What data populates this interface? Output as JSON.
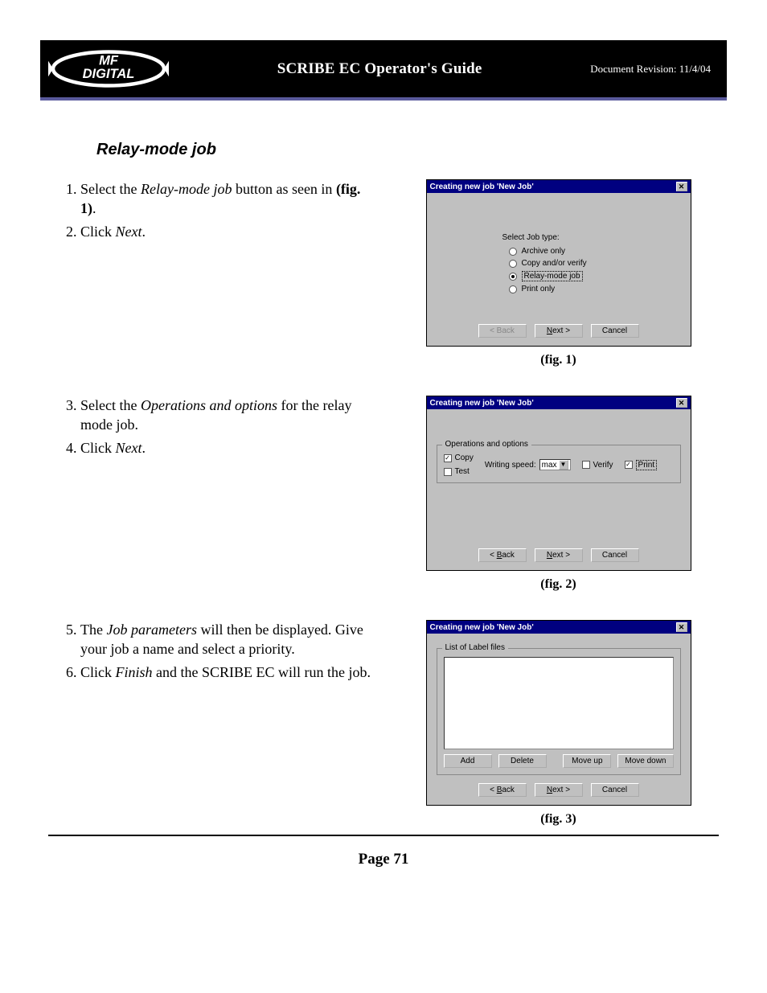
{
  "header": {
    "logo_text": "MF DIGITAL",
    "title": "SCRIBE EC Operator's Guide",
    "revision_label": "Document Revision: ",
    "revision_date": "11/4/04"
  },
  "section_title": "Relay-mode job",
  "steps": {
    "s1_a": "Select the ",
    "s1_em": "Relay-mode job",
    "s1_b": " button as seen in ",
    "s1_fig": "(fig. 1)",
    "s1_c": ".",
    "s2_a": "Click ",
    "s2_em": "Next",
    "s2_b": ".",
    "s3_a": "Select the ",
    "s3_em": "Operations and options",
    "s3_b": " for the relay mode job.",
    "s4_a": "Click ",
    "s4_em": "Next",
    "s4_b": ".",
    "s5_a": "The ",
    "s5_em": "Job parameters",
    "s5_b": " will then be displayed. Give your job a name and select a priority.",
    "s6_a": "Click ",
    "s6_em": "Finish",
    "s6_b": " and the SCRIBE EC will run the job."
  },
  "dialogs": {
    "title": "Creating new job 'New Job'",
    "close_glyph": "✕",
    "back": "< Back",
    "next": "Next >",
    "cancel": "Cancel",
    "fig1": {
      "select_label": "Select Job type:",
      "opt_archive": "Archive only",
      "opt_copy": "Copy and/or verify",
      "opt_relay": "Relay-mode job",
      "opt_print": "Print only"
    },
    "fig2": {
      "group": "Operations and options",
      "copy": "Copy",
      "test": "Test",
      "speed_label": "Writing speed:",
      "speed_value": "max",
      "verify": "Verify",
      "print": "Print"
    },
    "fig3": {
      "group": "List of Label files",
      "add": "Add",
      "delete": "Delete",
      "moveup": "Move up",
      "movedown": "Move down"
    }
  },
  "captions": {
    "fig1": "(fig. 1)",
    "fig2": "(fig. 2)",
    "fig3": "(fig. 3)"
  },
  "footer": {
    "page": "Page 71"
  }
}
